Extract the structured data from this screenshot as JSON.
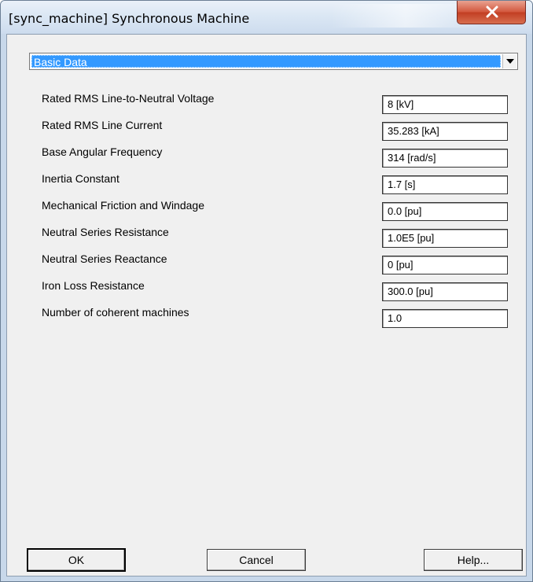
{
  "window": {
    "title": "[sync_machine] Synchronous Machine"
  },
  "page_selector": {
    "selected": "Basic Data"
  },
  "parameters": [
    {
      "label": "Rated RMS Line-to-Neutral Voltage",
      "value": "8 [kV]"
    },
    {
      "label": "Rated RMS Line Current",
      "value": "35.283 [kA]"
    },
    {
      "label": "Base Angular Frequency",
      "value": "314 [rad/s]"
    },
    {
      "label": "Inertia Constant",
      "value": "1.7 [s]"
    },
    {
      "label": "Mechanical Friction and Windage",
      "value": "0.0 [pu]"
    },
    {
      "label": "Neutral Series Resistance",
      "value": "1.0E5 [pu]"
    },
    {
      "label": "Neutral Series Reactance",
      "value": "0 [pu]"
    },
    {
      "label": "Iron Loss Resistance",
      "value": "300.0 [pu]"
    },
    {
      "label": "Number of coherent machines",
      "value": "1.0"
    }
  ],
  "buttons": {
    "ok": "OK",
    "cancel": "Cancel",
    "help": "Help..."
  },
  "icons": {
    "close": "close-icon",
    "dropdown": "chevron-down-icon"
  },
  "colors": {
    "selection_blue": "#3399ff",
    "close_red": "#c23e23",
    "dialog_face": "#f0f0f0"
  }
}
